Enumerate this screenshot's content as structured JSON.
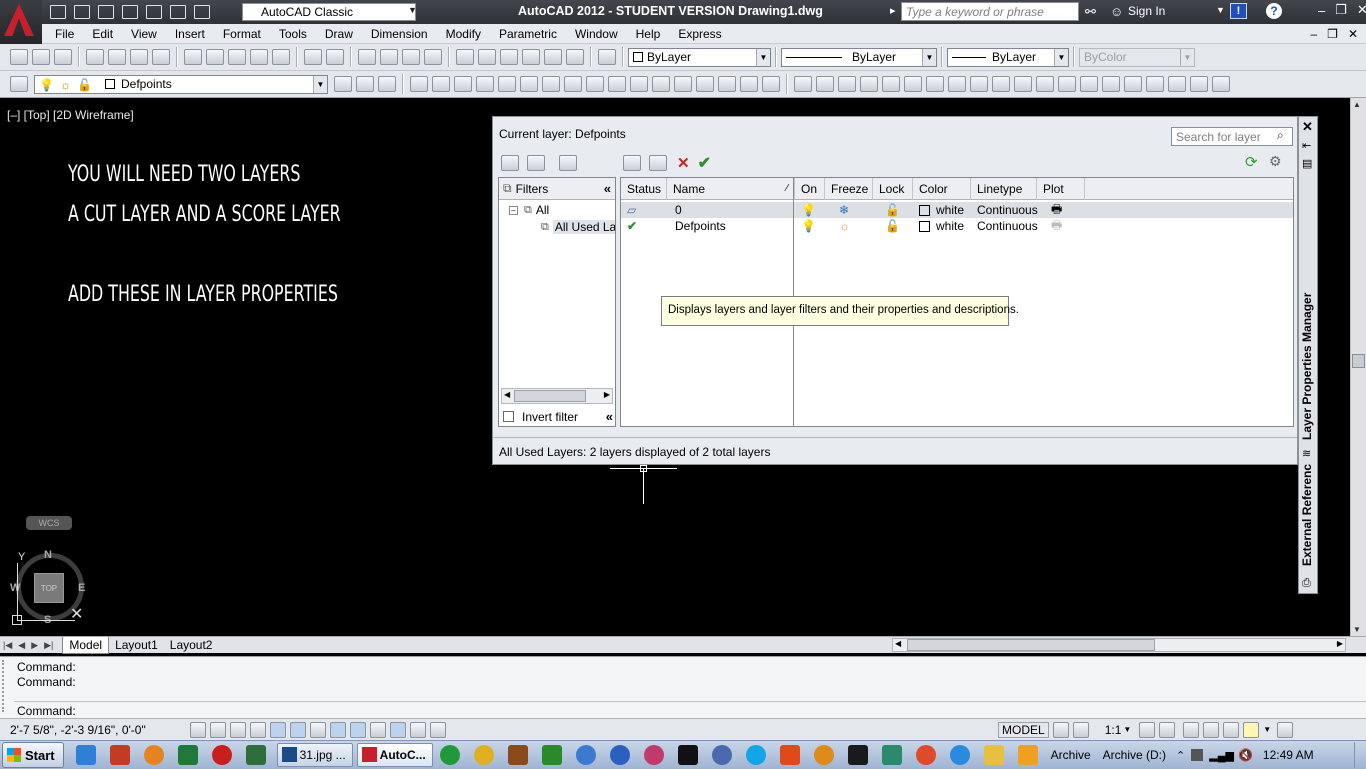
{
  "title_bar": {
    "workspace": "AutoCAD Classic",
    "app_title": "AutoCAD 2012 - STUDENT VERSION    Drawing1.dwg",
    "search_placeholder": "Type a keyword or phrase",
    "sign_in": "Sign In"
  },
  "menu": [
    "File",
    "Edit",
    "View",
    "Insert",
    "Format",
    "Tools",
    "Draw",
    "Dimension",
    "Modify",
    "Parametric",
    "Window",
    "Help",
    "Express"
  ],
  "properties_toolbar": {
    "color": "ByLayer",
    "linetype": "ByLayer",
    "lineweight": "ByLayer",
    "plotstyle": "ByColor"
  },
  "layer_toolbar": {
    "current_layer": "Defpoints"
  },
  "viewport_label": "[–] [Top] [2D Wireframe]",
  "drawing_text": [
    "YOU WILL NEED TWO LAYERS",
    "A CUT LAYER AND A SCORE LAYER",
    "ADD THESE IN LAYER PROPERTIES"
  ],
  "viewcube": {
    "top": "TOP",
    "n": "N",
    "s": "S",
    "e": "E",
    "w": "W",
    "wcs": "WCS",
    "y": "Y"
  },
  "layer_manager": {
    "current_layer_label": "Current layer: Defpoints",
    "search_placeholder": "Search for layer",
    "filters_header": "Filters",
    "filter_tree": [
      "All",
      "All Used La"
    ],
    "invert_filter": "Invert filter",
    "columns": [
      "Status",
      "Name",
      "On",
      "Freeze",
      "Lock",
      "Color",
      "Linetype",
      "Plot"
    ],
    "rows": [
      {
        "name": "0",
        "color": "white",
        "linetype": "Continuous"
      },
      {
        "name": "Defpoints",
        "color": "white",
        "linetype": "Continuous"
      }
    ],
    "tooltip": "Displays layers and layer filters and their properties and descriptions.",
    "status_line": "All Used Layers: 2 layers displayed of 2 total layers",
    "palette_title": "Layer Properties Manager",
    "palette_title2": "External Referenc"
  },
  "layout_tabs": [
    "Model",
    "Layout1",
    "Layout2"
  ],
  "command_lines": [
    "Command:",
    "Command:",
    "Command:"
  ],
  "status_bar": {
    "coords": "2'-7 5/8\",  -2'-3 9/16\", 0'-0\"",
    "model": "MODEL",
    "scale": "1:1"
  },
  "taskbar": {
    "start": "Start",
    "task1": "31.jpg ...",
    "task2": "AutoC...",
    "tray1": "Archive",
    "tray2": "Archive (D:)",
    "clock": "12:49 AM"
  },
  "colors": {
    "accent_red": "#c8202a",
    "canvas": "#000000",
    "titlebar": "#3a3d42",
    "taskbar": "#b3c4de"
  }
}
